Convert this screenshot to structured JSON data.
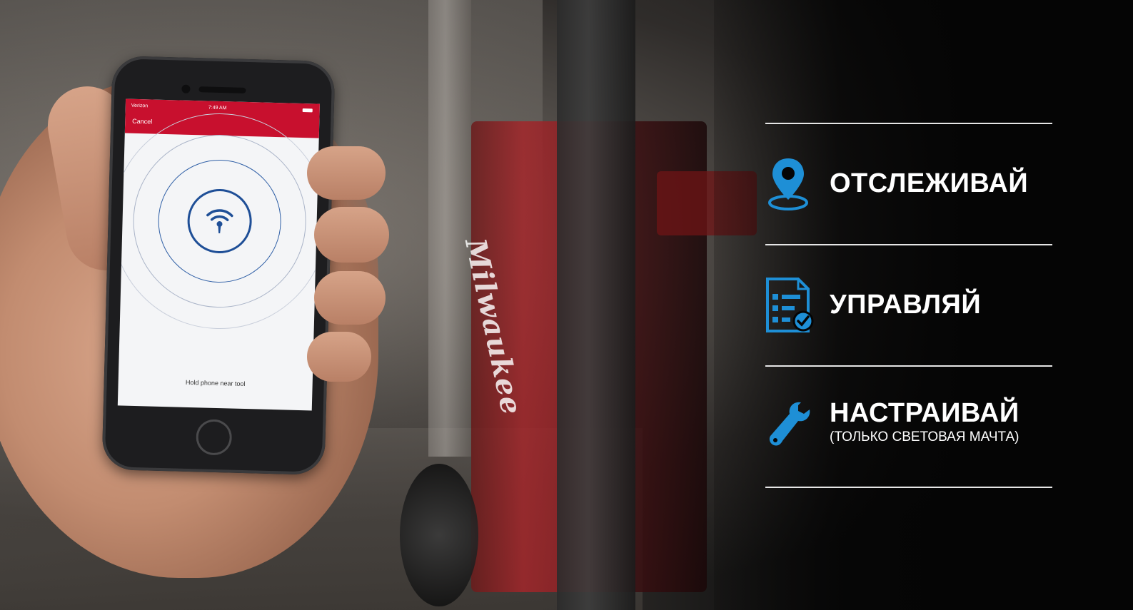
{
  "phone": {
    "status_left": "Verizon",
    "status_time": "7:49 AM",
    "cancel_label": "Cancel",
    "hint": "Hold phone near tool"
  },
  "equipment": {
    "brand": "Milwaukee"
  },
  "features": [
    {
      "title": "ОТСЛЕЖИВАЙ",
      "subtitle": "",
      "icon": "map-pin-icon"
    },
    {
      "title": "УПРАВЛЯЙ",
      "subtitle": "",
      "icon": "checklist-document-icon"
    },
    {
      "title": "НАСТРАИВАЙ",
      "subtitle": "(ТОЛЬКО СВЕТОВАЯ МАЧТА)",
      "icon": "wrench-icon"
    }
  ],
  "colors": {
    "accent_blue": "#1e8fd6",
    "app_red": "#c8102e",
    "rule": "#e6e6e6",
    "text": "#ffffff"
  }
}
